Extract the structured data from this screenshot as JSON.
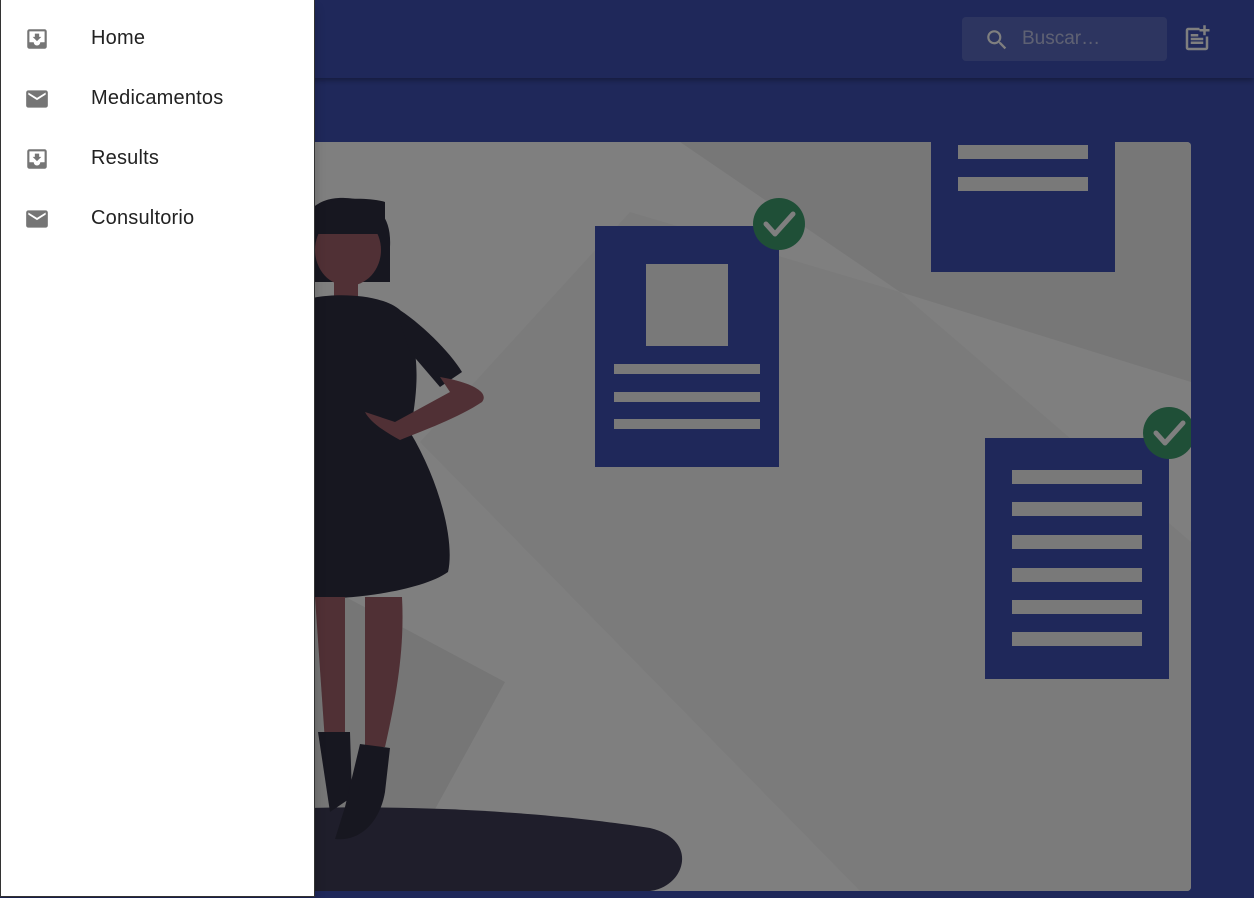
{
  "drawer": {
    "items": [
      {
        "label": "Home",
        "icon": "inbox-icon"
      },
      {
        "label": "Medicamentos",
        "icon": "mail-icon"
      },
      {
        "label": "Results",
        "icon": "inbox-icon"
      },
      {
        "label": "Consultorio",
        "icon": "mail-icon"
      }
    ]
  },
  "appbar": {
    "search": {
      "placeholder": "Buscar…",
      "icon": "search-icon"
    },
    "action_icon": "note-add-icon"
  },
  "colors": {
    "primary": "#3f51b5",
    "check_green": "#3f9e6f",
    "skin": "#a0616a",
    "dress": "#2f2e41"
  }
}
